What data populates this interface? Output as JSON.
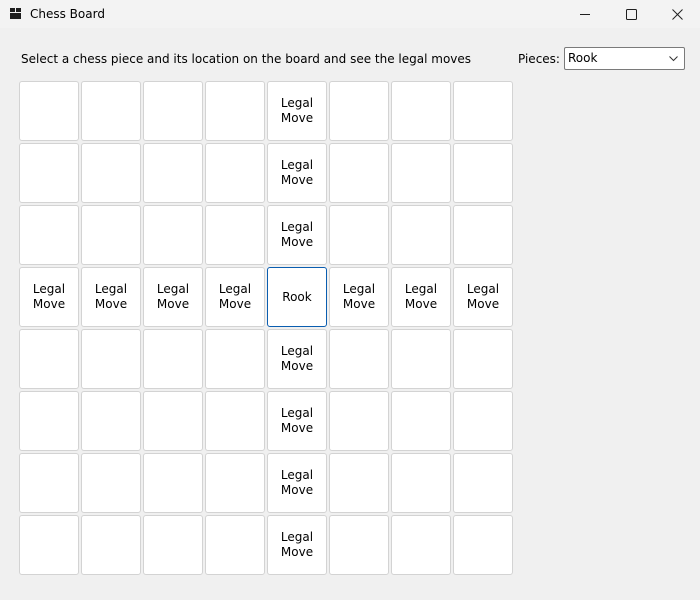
{
  "window": {
    "title": "Chess Board",
    "icon": "app-window-icon",
    "controls": [
      "minimize-icon",
      "maximize-icon",
      "close-icon"
    ]
  },
  "header": {
    "instruction": "Select a chess piece and its location on the board and see the legal moves",
    "pieces_label": "Pieces:",
    "selected_piece": "Rook"
  },
  "board": {
    "rows": [
      [
        "",
        "",
        "",
        "",
        "Legal Move",
        "",
        "",
        ""
      ],
      [
        "",
        "",
        "",
        "",
        "Legal Move",
        "",
        "",
        ""
      ],
      [
        "",
        "",
        "",
        "",
        "Legal Move",
        "",
        "",
        ""
      ],
      [
        "Legal Move",
        "Legal Move",
        "Legal Move",
        "Legal Move",
        "Rook",
        "Legal Move",
        "Legal Move",
        "Legal Move"
      ],
      [
        "",
        "",
        "",
        "",
        "Legal Move",
        "",
        "",
        ""
      ],
      [
        "",
        "",
        "",
        "",
        "Legal Move",
        "",
        "",
        ""
      ],
      [
        "",
        "",
        "",
        "",
        "Legal Move",
        "",
        "",
        ""
      ],
      [
        "",
        "",
        "",
        "",
        "Legal Move",
        "",
        "",
        ""
      ]
    ],
    "selected_row": 3,
    "selected_col": 4
  },
  "colors": {
    "background": "#f0f0f0",
    "square": "#ffffff",
    "square_border": "#d3d3d3",
    "selected_border": "#0a5db0"
  }
}
